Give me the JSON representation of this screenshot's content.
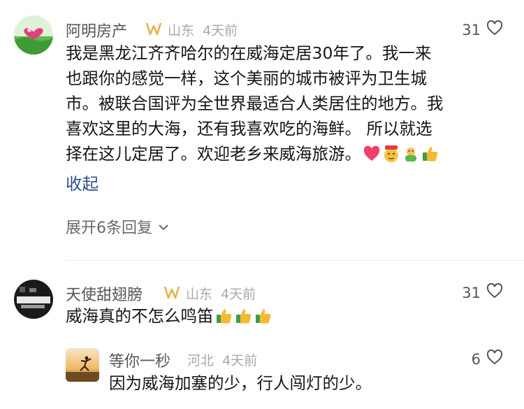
{
  "comments": [
    {
      "user": "阿明房产",
      "location": "山东",
      "time": "4天前",
      "likes": "31",
      "lines": [
        "我是黑龙江齐齐哈尔的在威海定居30年了。我一来",
        "也跟你的感觉一样，这个美丽的城市被评为卫生城",
        "市。被联合国评为全世界最适合人类居住的地方。我",
        "喜欢这里的大海，还有我喜欢吃的海鲜。 所以就选",
        "择在这儿定居了。欢迎老乡来威海旅游。"
      ],
      "collapse_label": "收起",
      "expand_label": "展开6条回复"
    },
    {
      "user": "天使甜翅膀",
      "location": "山东",
      "time": "4天前",
      "likes": "31",
      "text": "威海真的不怎么鸣笛"
    }
  ],
  "reply": {
    "user": "等你一秒",
    "location": "河北",
    "time": "4天前",
    "likes": "6",
    "text": "因为威海加塞的少，行人闯灯的少。"
  },
  "colors": {
    "link": "#2f4f8a",
    "name": "#555555",
    "meta": "#a8a8a8",
    "badge": "#e0b64a"
  },
  "icons": {
    "like": "heart-outline-icon",
    "badge": "vip-badge-icon",
    "expand": "chevron-down-icon"
  }
}
